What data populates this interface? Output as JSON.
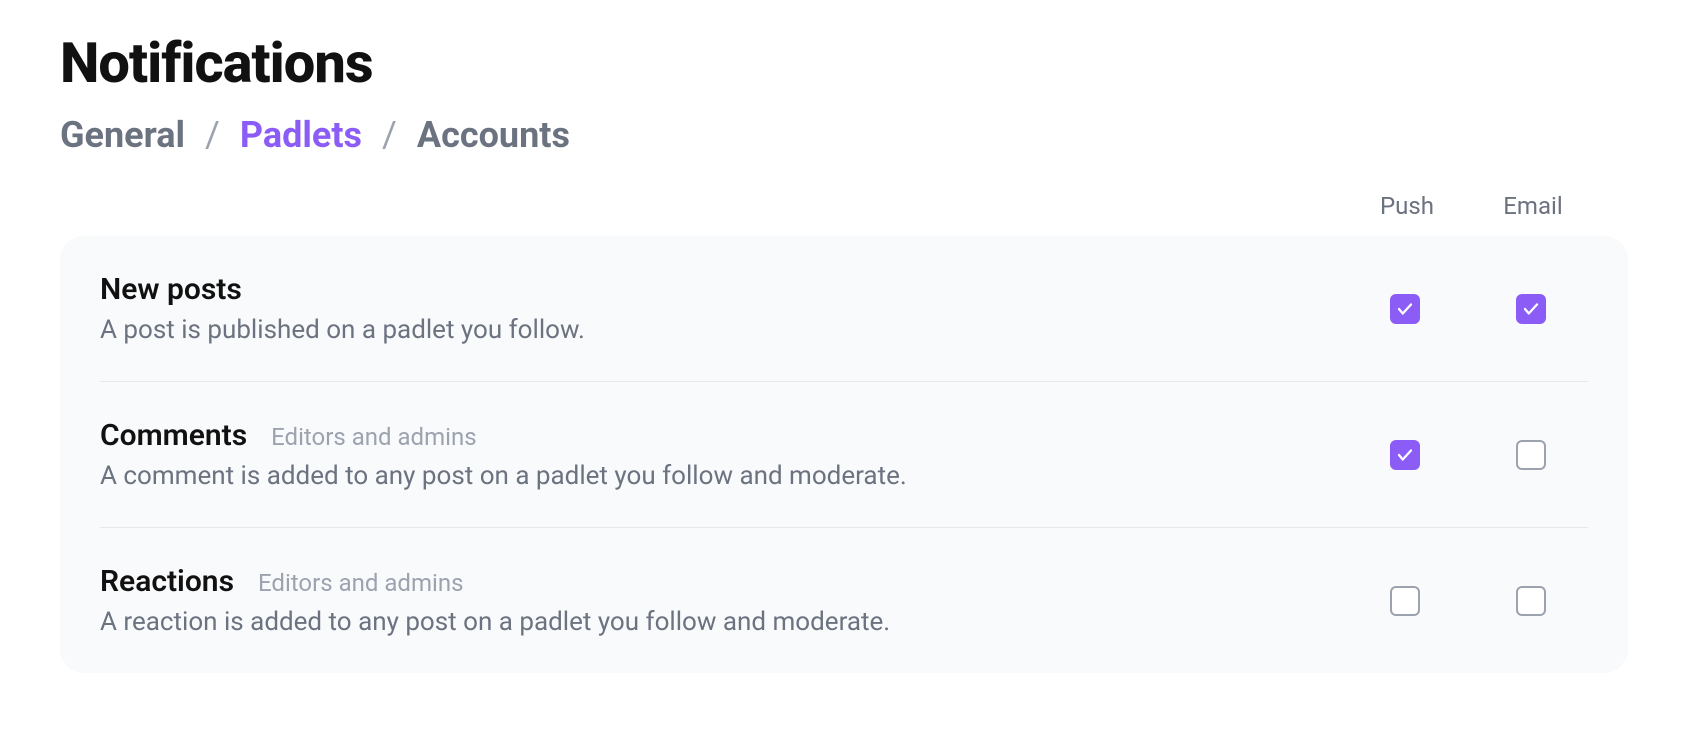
{
  "title": "Notifications",
  "tabs": {
    "general": "General",
    "padlets": "Padlets",
    "accounts": "Accounts",
    "separator": "/"
  },
  "columns": {
    "push": "Push",
    "email": "Email"
  },
  "rows": [
    {
      "title": "New posts",
      "badge": "",
      "desc": "A post is published on a padlet you follow.",
      "push": true,
      "email": true
    },
    {
      "title": "Comments",
      "badge": "Editors and admins",
      "desc": "A comment is added to any post on a padlet you follow and moderate.",
      "push": true,
      "email": false
    },
    {
      "title": "Reactions",
      "badge": "Editors and admins",
      "desc": "A reaction is added to any post on a padlet you follow and moderate.",
      "push": false,
      "email": false
    }
  ],
  "colors": {
    "accent": "#8b5cf6"
  }
}
